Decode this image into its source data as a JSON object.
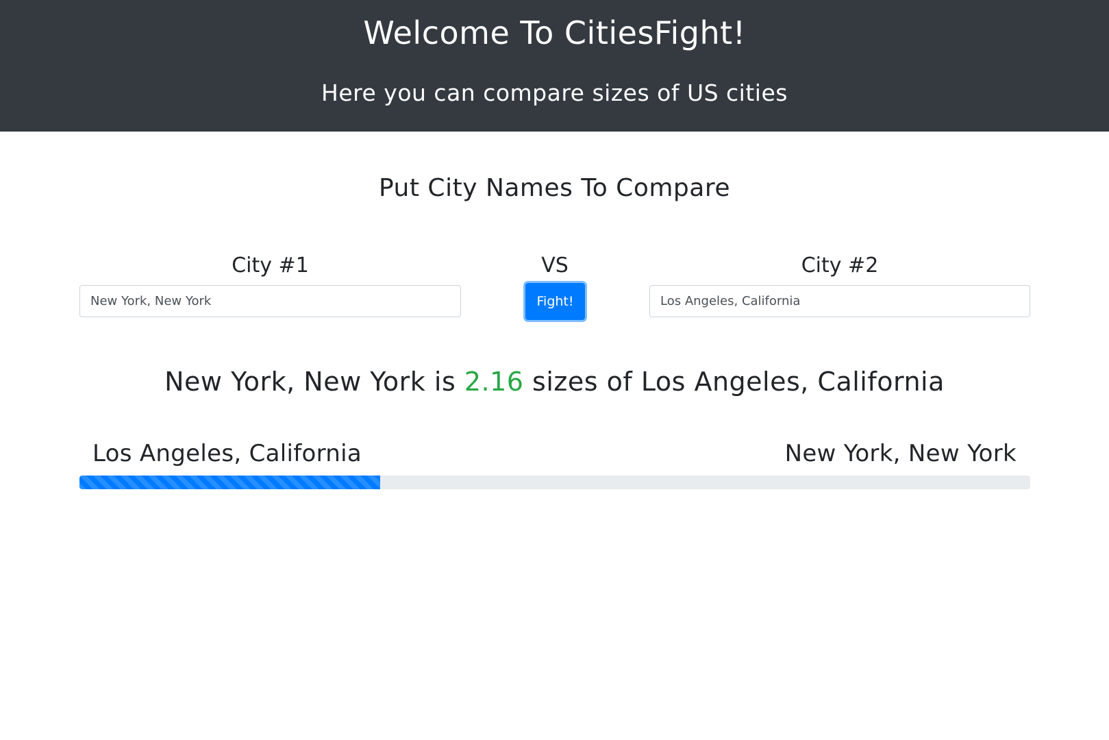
{
  "header": {
    "title": "Welcome To CitiesFight!",
    "subtitle": "Here you can compare sizes of US cities"
  },
  "form": {
    "section_title": "Put City Names To Compare",
    "city1_label": "City #1",
    "vs_label": "VS",
    "city2_label": "City #2",
    "city1_value": "New York, New York",
    "city2_value": "Los Angeles, California",
    "fight_button_label": "Fight!"
  },
  "result": {
    "city_a": "New York, New York",
    "is_text": "is",
    "ratio": "2.16",
    "sizes_of_text": "sizes of",
    "city_b": "Los Angeles, California",
    "bar_left_label": "Los Angeles, California",
    "bar_right_label": "New York, New York",
    "bar_fill_fraction": 0.316
  },
  "colors": {
    "header_bg": "#343a40",
    "accent": "#007bff",
    "ratio_text": "#28a745",
    "track": "#e9ecef"
  }
}
